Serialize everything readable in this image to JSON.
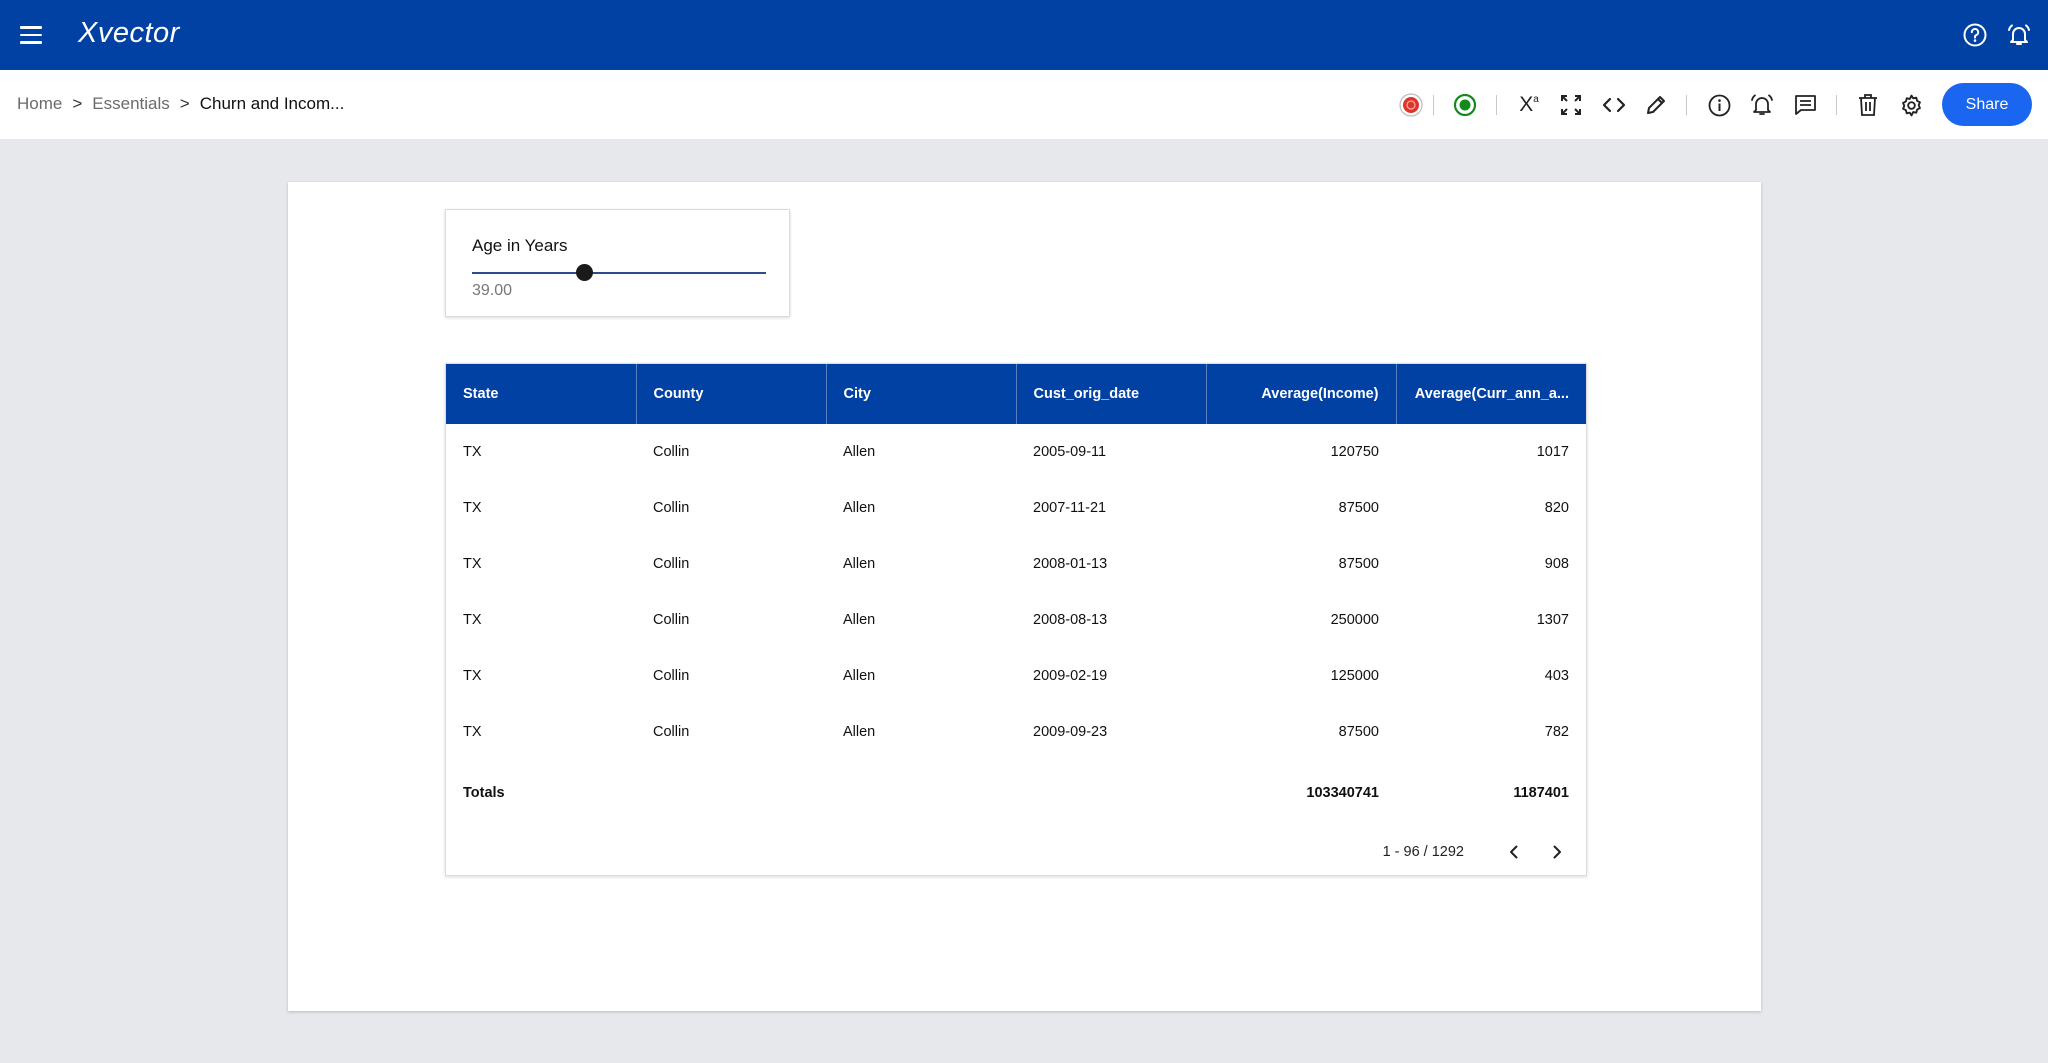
{
  "app": {
    "logo": "Xvector"
  },
  "breadcrumb": {
    "home": "Home",
    "essentials": "Essentials",
    "current": "Churn and Incom...",
    "separator": ">"
  },
  "toolbar": {
    "share_label": "Share",
    "formula_label": "X"
  },
  "colors": {
    "appbar": "#0041a3",
    "share": "#1a66f0",
    "status_green": "#148a1e",
    "status_red": "#e0342a"
  },
  "slider": {
    "label": "Age in Years",
    "value": "39.00",
    "position_fraction": 0.38
  },
  "table": {
    "columns": [
      "State",
      "County",
      "City",
      "Cust_orig_date",
      "Average(Income)",
      "Average(Curr_ann_a..."
    ],
    "rows": [
      [
        "TX",
        "Collin",
        "Allen",
        "2005-09-11",
        "120750",
        "1017"
      ],
      [
        "TX",
        "Collin",
        "Allen",
        "2007-11-21",
        "87500",
        "820"
      ],
      [
        "TX",
        "Collin",
        "Allen",
        "2008-01-13",
        "87500",
        "908"
      ],
      [
        "TX",
        "Collin",
        "Allen",
        "2008-08-13",
        "250000",
        "1307"
      ],
      [
        "TX",
        "Collin",
        "Allen",
        "2009-02-19",
        "125000",
        "403"
      ],
      [
        "TX",
        "Collin",
        "Allen",
        "2009-09-23",
        "87500",
        "782"
      ]
    ],
    "totals": {
      "label": "Totals",
      "income": "103340741",
      "curr": "1187401"
    },
    "pager": "1 - 96 / 1292"
  }
}
